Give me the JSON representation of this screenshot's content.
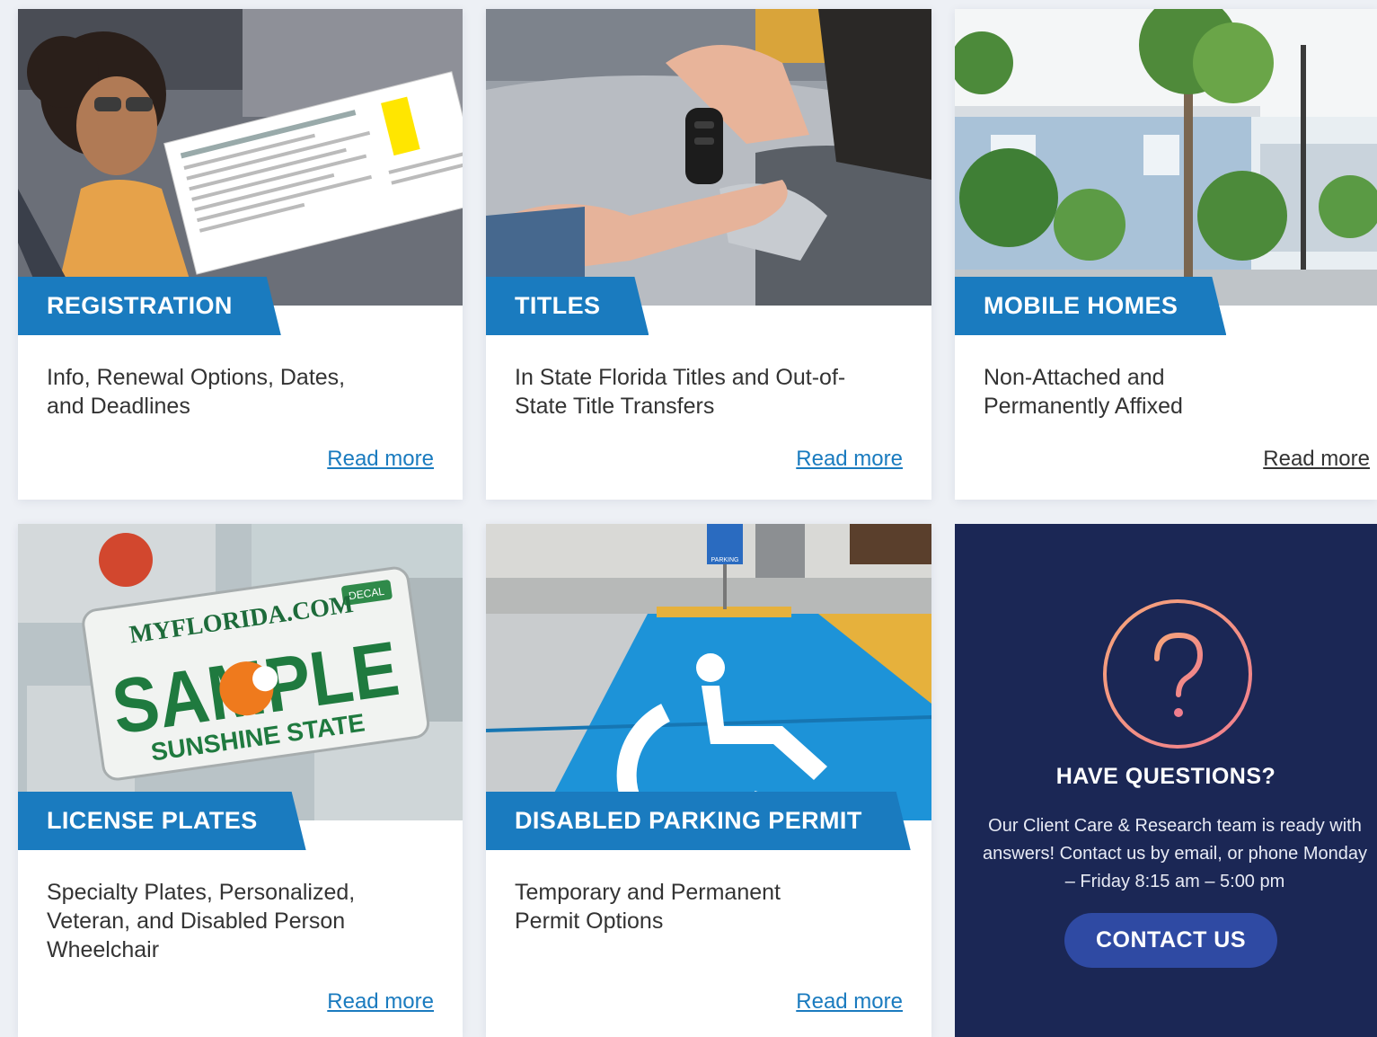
{
  "cards": [
    {
      "title": "REGISTRATION",
      "description": "Info, Renewal Options, Dates, and Deadlines",
      "link": "Read more",
      "image": "woman-in-car-with-registration-card"
    },
    {
      "title": "TITLES",
      "description": "In State Florida Titles and Out-of-State Title Transfers",
      "link": "Read more",
      "image": "car-key-handover"
    },
    {
      "title": "MOBILE HOMES",
      "description": "Non-Attached and Permanently Affixed",
      "link": "Read more",
      "image": "mobile-home-with-palm-trees"
    },
    {
      "title": "LICENSE PLATES",
      "description": "Specialty Plates, Personalized, Veteran, and Disabled Person Wheelchair",
      "link": "Read more",
      "image": "florida-sample-license-plate",
      "plate": {
        "top": "MYFLORIDA.COM",
        "middle": "SAMPLE",
        "bottom": "SUNSHINE STATE",
        "decal": "DECAL"
      }
    },
    {
      "title": "DISABLED PARKING PERMIT",
      "description": "Temporary and Permanent Permit Options",
      "link": "Read more",
      "image": "wheelchair-parking-space",
      "sign": "PARKING"
    }
  ],
  "help": {
    "icon": "question-circle-icon",
    "title": "HAVE QUESTIONS?",
    "text": "Our Client Care & Research team is ready with answers! Contact us by email, or phone Monday – Friday 8:15 am – 5:00 pm",
    "button": "CONTACT US"
  },
  "colors": {
    "accent": "#1a7bbf",
    "help_bg": "#1b2755",
    "button": "#2f4aa3"
  }
}
